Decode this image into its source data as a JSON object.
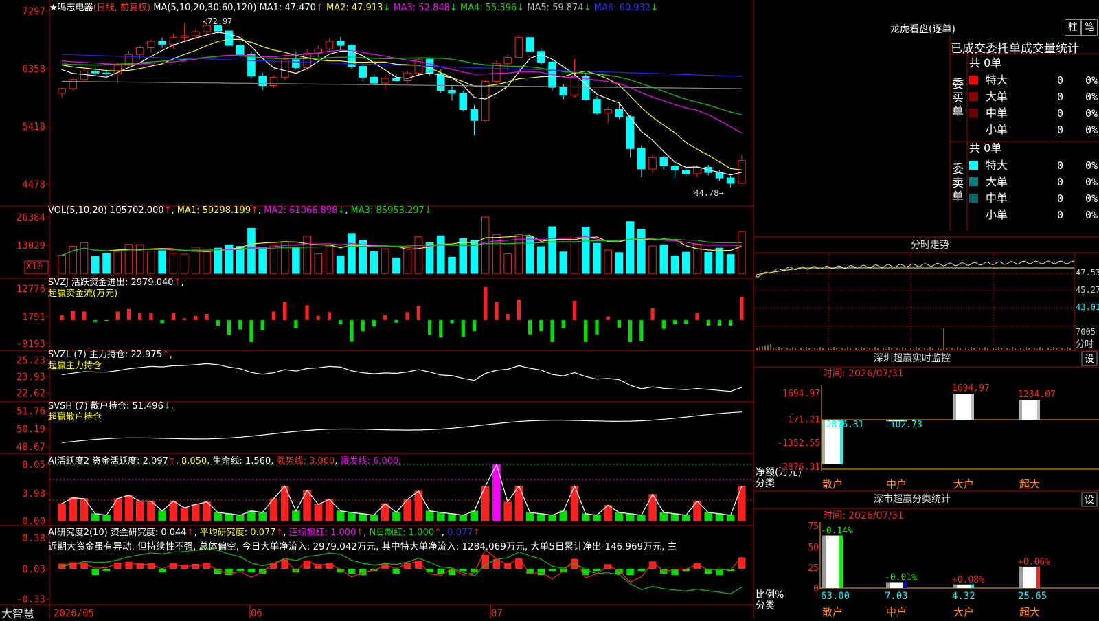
{
  "colors": {
    "up": "#ff2020",
    "down": "#00ffff",
    "grid": "#b00000",
    "ma1": "#ffffff",
    "ma2": "#ffff00",
    "ma3": "#ff00ff",
    "ma4": "#00cc00",
    "ma5": "#888888",
    "ma6": "#2020ff"
  },
  "chart_data": {
    "type": "candlestick",
    "dates_axis": [
      "2026/05",
      "06",
      "07"
    ],
    "y_ticks": [
      "7297",
      "6358",
      "5418",
      "4478"
    ],
    "candles": [
      [
        60.5,
        61.5,
        59.8,
        61.3
      ],
      [
        61.3,
        63.2,
        61,
        62.8
      ],
      [
        62.8,
        64.8,
        62.5,
        64.2
      ],
      [
        64.2,
        64.8,
        63.5,
        63.9
      ],
      [
        63.9,
        64.5,
        63,
        63.8
      ],
      [
        63.8,
        65.6,
        62.2,
        65.2
      ],
      [
        65.2,
        67.6,
        64.8,
        67
      ],
      [
        67,
        68.4,
        66.2,
        68.1
      ],
      [
        68.1,
        69.5,
        67.3,
        69.2
      ],
      [
        69.2,
        69.8,
        68.1,
        68.7
      ],
      [
        68.7,
        70.5,
        67.8,
        69.8
      ],
      [
        69.8,
        72.2,
        69,
        70.1
      ],
      [
        70.1,
        71.2,
        69.5,
        70.8
      ],
      [
        70.8,
        72.97,
        70,
        71.8
      ],
      [
        71.8,
        72.4,
        70.3,
        70.9
      ],
      [
        70.9,
        71,
        68.2,
        68.5
      ],
      [
        68.5,
        69.2,
        66.4,
        67
      ],
      [
        67,
        67.5,
        63,
        63.4
      ],
      [
        63.4,
        64,
        61,
        61.8
      ],
      [
        61.8,
        63.5,
        61.5,
        63.2
      ],
      [
        63.2,
        66.5,
        62.8,
        66.1
      ],
      [
        66.1,
        67.4,
        64.5,
        64.8
      ],
      [
        64.8,
        67.8,
        64.3,
        67.2
      ],
      [
        67.2,
        68.5,
        66.5,
        67.9
      ],
      [
        67.9,
        69.6,
        67.3,
        69.2
      ],
      [
        69.2,
        69.9,
        67.5,
        68.5
      ],
      [
        68.5,
        68.7,
        64.5,
        65
      ],
      [
        65,
        65.5,
        62.5,
        63.2
      ],
      [
        63.2,
        63.8,
        61.8,
        62.2
      ],
      [
        62.2,
        63.5,
        61.3,
        63
      ],
      [
        63,
        63.8,
        62.3,
        62.6
      ],
      [
        62.6,
        64.2,
        62,
        63.9
      ],
      [
        63.9,
        66.5,
        63.5,
        66.2
      ],
      [
        66.2,
        66.5,
        63.5,
        63.8
      ],
      [
        63.8,
        64.5,
        60.5,
        61
      ],
      [
        61,
        61.8,
        59.3,
        60.5
      ],
      [
        60.5,
        61,
        57.5,
        57.8
      ],
      [
        57.8,
        58.6,
        53.5,
        56
      ],
      [
        56,
        62.8,
        55.8,
        62.5
      ],
      [
        62.5,
        66,
        62,
        65.5
      ],
      [
        65.5,
        67,
        64.3,
        66.5
      ],
      [
        66.5,
        70.2,
        66,
        69.8
      ],
      [
        69.8,
        70.4,
        67,
        67.5
      ],
      [
        67.5,
        68,
        65.3,
        65.7
      ],
      [
        65.7,
        66.2,
        61,
        61.5
      ],
      [
        61.5,
        62,
        59.5,
        60.2
      ],
      [
        60.2,
        66.2,
        59.8,
        63.3
      ],
      [
        63.3,
        63.7,
        59.3,
        59.5
      ],
      [
        59.5,
        60,
        56.8,
        57.2
      ],
      [
        57.2,
        58.2,
        55.5,
        57.8
      ],
      [
        57.8,
        59,
        56.2,
        56.6
      ],
      [
        56.6,
        56.9,
        49.8,
        51.3
      ],
      [
        51.3,
        51.8,
        46.5,
        47.9
      ],
      [
        47.9,
        50.4,
        47.2,
        49.8
      ],
      [
        49.8,
        50.2,
        47.8,
        48.4
      ],
      [
        48.4,
        49,
        46.4,
        47.7
      ],
      [
        47.7,
        48.1,
        46.7,
        47.1
      ],
      [
        47.1,
        48.5,
        46.5,
        48.2
      ],
      [
        48.2,
        48.6,
        46.8,
        47.3
      ],
      [
        47.3,
        47.7,
        45.9,
        46.4
      ],
      [
        46.4,
        46.8,
        44.78,
        45.5
      ],
      [
        45.5,
        50.2,
        45.4,
        49.3
      ]
    ],
    "ma_vals": {
      "MA1": 47.47,
      "MA2": 47.913,
      "MA3": 52.848,
      "MA4": 55.396,
      "MA5": 59.874,
      "MA6": 60.932
    },
    "high_label": "72.97",
    "low_label": "44.78"
  },
  "main": {
    "title_star": "★",
    "title_name": "鸣志电器",
    "title_mode": "(日线, 前复权)",
    "title_ma": "MA(5,10,20,30,60,120)",
    "ma1": "MA1: 47.470",
    "ma2": "MA2: 47.913",
    "ma3": "MA3: 52.848",
    "ma4": "MA4: 55.396",
    "ma5": "MA5: 59.874",
    "ma6": "MA6: 60.932",
    "high": "72.97",
    "low": "44.78"
  },
  "vol": {
    "title": "VOL(5,10,20)",
    "value": "105702.000",
    "ma1": "MA1: 59298.199",
    "ma2": "MA2: 61066.898",
    "ma3": "MA3: 85953.297",
    "ticks": [
      "26384",
      "13029"
    ],
    "x10": "X10"
  },
  "svzj": {
    "title": "SVZJ  活跃资金进出: 2979.040",
    "sub": "超赢资金流(万元)",
    "ticks": [
      "12776",
      "1791",
      "-9193"
    ]
  },
  "svzl": {
    "title": "SVZL (7) 主力持仓: 22.975",
    "sub": "超赢主力持仓",
    "ticks": [
      "25.23",
      "23.93",
      "22.62"
    ]
  },
  "svsh": {
    "title": "SVSH (7) 散户持仓: 51.496",
    "sub": "超赢散户持仓",
    "ticks": [
      "51.76",
      "50.19",
      "48.67"
    ]
  },
  "ai1": {
    "title": "AI活跃度2 资金活跃度: 2.097",
    "v2": "8.050",
    "v3": "生命线: 1.560",
    "v4": "强势线: 3.000",
    "v5": "爆发线: 6.000",
    "ticks": [
      "8.05",
      "3.98",
      "0.00"
    ]
  },
  "ai2": {
    "title": "AI研究度2(10) 资金研究度: 0.044",
    "v2": "平均研究度: 0.077",
    "v3": "连续飘红: 1.000",
    "v4": "N日飘红: 1.000",
    "v5": "0.077",
    "text": "近期大资金虽有异动, 但持续性不强, 总体偏空, 今日大单净流入: 2979.042万元, 其中特大单净流入: 1284.069万元, 大单5日累计净出-146.969万元, 主",
    "ticks": [
      "0.38",
      "0.03",
      "-0.33"
    ]
  },
  "brand": "大智慧",
  "right": {
    "lhkp": "龙虎看盘(逐单)",
    "btn_zhu": "柱",
    "btn_bi": "笔",
    "header": "已成交委托单成交量统计",
    "buy_label": "委买单",
    "sell_label": "委卖单",
    "buy_total": "共 0单",
    "sell_total": "共 0单",
    "rows": [
      {
        "name": "特大",
        "v": "0",
        "p": "0%"
      },
      {
        "name": "大单",
        "v": "0",
        "p": "0%"
      },
      {
        "name": "中单",
        "v": "0",
        "p": "0%"
      },
      {
        "name": "小单",
        "v": "0",
        "p": "0%"
      }
    ],
    "fs_title": "分时走势",
    "fs_ticks": [
      "47.53",
      "45.27",
      "43.01",
      "7005"
    ],
    "fs_unit": "分时",
    "sz_title": "深圳超赢实时监控",
    "sz_time": "时间: 2026/07/31",
    "btn_set": "设",
    "sz_ticks": [
      "1694.97",
      "171.21",
      "-1352.55",
      "-2876.31"
    ],
    "sz_net": "净额(万元)",
    "sz_cls": "分类",
    "sz_values": [
      {
        "cat": "散户",
        "v": -2876.31,
        "label": "-2876.31"
      },
      {
        "cat": "中户",
        "v": -102.73,
        "label": "-102.73"
      },
      {
        "cat": "大户",
        "v": 1694.97,
        "label": "1694.97"
      },
      {
        "cat": "超大",
        "v": 1284.07,
        "label": "1284.07"
      }
    ],
    "ss_title": "深市超赢分类统计",
    "ss_time": "时间: 2026/07/31",
    "ss_ticks": [
      "75",
      "50",
      "25",
      "0"
    ],
    "ss_ratio": "比例%",
    "ss_cls": "分类",
    "ss_values": [
      {
        "cat": "散户",
        "pct": 63.0,
        "chg": "-0.14%",
        "label": "63.00"
      },
      {
        "cat": "中户",
        "pct": 7.03,
        "chg": "-0.01%",
        "label": "7.03"
      },
      {
        "cat": "大户",
        "pct": 4.32,
        "chg": "+0.08%",
        "label": "4.32"
      },
      {
        "cat": "超大",
        "pct": 25.65,
        "chg": "+0.06%",
        "label": "25.65"
      }
    ]
  }
}
